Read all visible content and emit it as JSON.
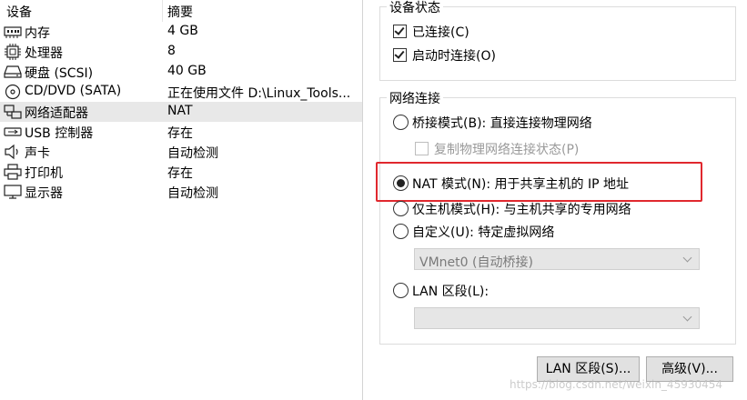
{
  "device_list": {
    "header": {
      "device": "设备",
      "summary": "摘要"
    },
    "rows": [
      {
        "icon": "memory-icon",
        "name": "内存",
        "summary": "4 GB"
      },
      {
        "icon": "processor-icon",
        "name": "处理器",
        "summary": "8"
      },
      {
        "icon": "harddisk-icon",
        "name": "硬盘 (SCSI)",
        "summary": "40 GB"
      },
      {
        "icon": "cd-dvd-icon",
        "name": "CD/DVD (SATA)",
        "summary": "正在使用文件 D:\\Linux_Tools..."
      },
      {
        "icon": "network-adapter-icon",
        "name": "网络适配器",
        "summary": "NAT",
        "selected": true
      },
      {
        "icon": "usb-icon",
        "name": "USB 控制器",
        "summary": "存在"
      },
      {
        "icon": "sound-card-icon",
        "name": "声卡",
        "summary": "自动检测"
      },
      {
        "icon": "printer-icon",
        "name": "打印机",
        "summary": "存在"
      },
      {
        "icon": "display-icon",
        "name": "显示器",
        "summary": "自动检测"
      }
    ]
  },
  "device_status": {
    "title": "设备状态",
    "connected": {
      "label": "已连接(C)",
      "checked": true
    },
    "connect_at_power_on": {
      "label": "启动时连接(O)",
      "checked": true
    }
  },
  "network_connection": {
    "title": "网络连接",
    "bridged": {
      "label": "桥接模式(B): 直接连接物理网络",
      "selected": false
    },
    "replicate_state": {
      "label": "复制物理网络连接状态(P)",
      "checked": false,
      "disabled": true
    },
    "nat": {
      "label": "NAT 模式(N): 用于共享主机的 IP 地址",
      "selected": true
    },
    "host_only": {
      "label": "仅主机模式(H): 与主机共享的专用网络",
      "selected": false
    },
    "custom": {
      "label": "自定义(U): 特定虚拟网络",
      "selected": false
    },
    "custom_select_value": "VMnet0 (自动桥接)",
    "lan_segment": {
      "label": "LAN 区段(L):",
      "selected": false
    },
    "lan_select_value": ""
  },
  "buttons": {
    "lan_segments": "LAN 区段(S)...",
    "advanced": "高级(V)..."
  },
  "watermark": "https://blog.csdn.net/weixin_45930454",
  "colors": {
    "highlight": "#e0282e",
    "selected_row": "#e8e8e8",
    "disabled_text": "#9a9a9a"
  }
}
